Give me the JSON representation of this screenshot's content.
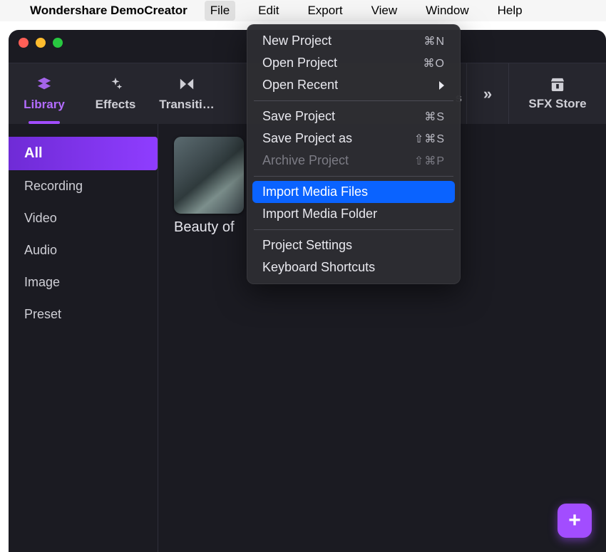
{
  "menubar": {
    "app_name": "Wondershare DemoCreator",
    "items": [
      "File",
      "Edit",
      "Export",
      "View",
      "Window",
      "Help"
    ],
    "open_index": 0
  },
  "file_menu": {
    "groups": [
      [
        {
          "label": "New Project",
          "shortcut": "⌘N"
        },
        {
          "label": "Open Project",
          "shortcut": "⌘O"
        },
        {
          "label": "Open Recent",
          "submenu": true
        }
      ],
      [
        {
          "label": "Save Project",
          "shortcut": "⌘S"
        },
        {
          "label": "Save Project as",
          "shortcut": "⇧⌘S"
        },
        {
          "label": "Archive Project",
          "shortcut": "⇧⌘P",
          "disabled": true
        }
      ],
      [
        {
          "label": "Import Media Files",
          "highlight": true
        },
        {
          "label": "Import Media Folder"
        }
      ],
      [
        {
          "label": "Project Settings"
        },
        {
          "label": "Keyboard Shortcuts"
        }
      ]
    ]
  },
  "toolbar": {
    "tabs": [
      {
        "label": "Library",
        "icon": "layers-icon",
        "active": true
      },
      {
        "label": "Effects",
        "icon": "sparkle-icon"
      },
      {
        "label": "Transiti…",
        "icon": "bowtie-icon"
      }
    ],
    "overflow_label": "»",
    "sfx_label": "SFX Store",
    "hidden_tab_tail": "s"
  },
  "sidebar": {
    "items": [
      {
        "label": "All",
        "active": true
      },
      {
        "label": "Recording"
      },
      {
        "label": "Video"
      },
      {
        "label": "Audio"
      },
      {
        "label": "Image"
      },
      {
        "label": "Preset"
      }
    ]
  },
  "content": {
    "items": [
      {
        "title": "Beauty of"
      }
    ]
  },
  "fab": {
    "glyph": "+"
  }
}
